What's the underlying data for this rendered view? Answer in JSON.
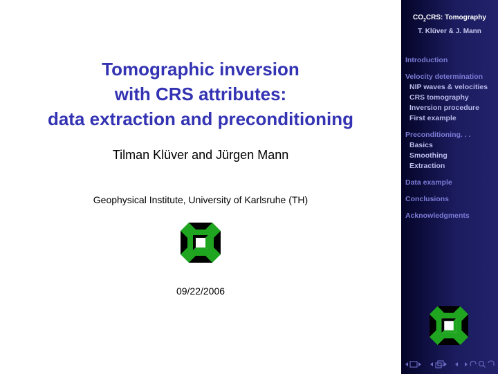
{
  "slide": {
    "title_lines": [
      "Tomographic inversion",
      "with CRS attributes:",
      "data extraction and preconditioning"
    ],
    "authors": "Tilman Klüver and Jürgen Mann",
    "institute": "Geophysical Institute, University of Karlsruhe (TH)",
    "date": "09/22/2006"
  },
  "sidebar": {
    "header_pre": "CO",
    "header_sub": "2",
    "header_post": "CRS: Tomography",
    "authors_short": "T. Klüver & J. Mann",
    "nav": [
      {
        "label": "Introduction",
        "subs": []
      },
      {
        "label": "Velocity determination",
        "subs": [
          "NIP waves & velocities",
          "CRS tomography",
          "Inversion procedure",
          "First example"
        ]
      },
      {
        "label": "Preconditioning. . .",
        "subs": [
          "Basics",
          "Smoothing",
          "Extraction"
        ]
      },
      {
        "label": "Data example",
        "subs": []
      },
      {
        "label": "Conclusions",
        "subs": []
      },
      {
        "label": "Acknowledgments",
        "subs": []
      }
    ]
  },
  "colors": {
    "title": "#3333b3",
    "sidebar_dark": "#040428",
    "sidebar_light": "#22226c",
    "logo_green": "#1fa51f",
    "logo_black": "#000000"
  },
  "icons": [
    "university-logo-icon",
    "beamer-navigation-icons"
  ]
}
